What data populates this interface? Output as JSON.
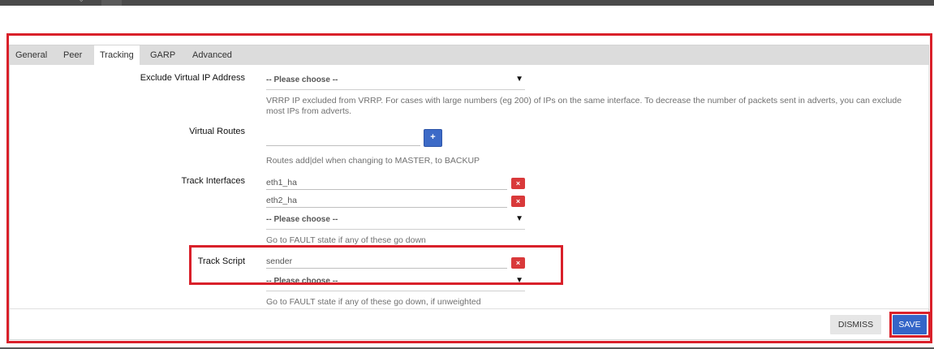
{
  "topbar": {
    "chevron_icon": "chevron-down-icon"
  },
  "tabs": [
    {
      "label": "General"
    },
    {
      "label": "Peer"
    },
    {
      "label": "Tracking",
      "active": true
    },
    {
      "label": "GARP"
    },
    {
      "label": "Advanced"
    }
  ],
  "fields": {
    "exclude_vip": {
      "label": "Exclude Virtual IP Address",
      "select_value": "-- Please choose --",
      "help": "VRRP IP excluded from VRRP. For cases with large numbers (eg 200) of IPs on the same interface. To decrease the number of packets sent in adverts, you can exclude most IPs from adverts."
    },
    "virtual_routes": {
      "label": "Virtual Routes",
      "value": "",
      "add_label": "+",
      "help": "Routes add|del when changing to MASTER, to BACKUP"
    },
    "track_interfaces": {
      "label": "Track Interfaces",
      "items": [
        "eth1_ha",
        "eth2_ha"
      ],
      "remove_label": "×",
      "select_value": "-- Please choose --",
      "help": "Go to FAULT state if any of these go down"
    },
    "track_script": {
      "label": "Track Script",
      "items": [
        "sender"
      ],
      "remove_label": "×",
      "select_value": "-- Please choose --",
      "help": "Go to FAULT state if any of these go down, if unweighted"
    }
  },
  "footer": {
    "dismiss_label": "DISMISS",
    "save_label": "SAVE"
  },
  "colors": {
    "highlight": "#d9202a",
    "primary": "#3465c8",
    "danger": "#d9393a",
    "tabbar": "#dcdcdc"
  }
}
